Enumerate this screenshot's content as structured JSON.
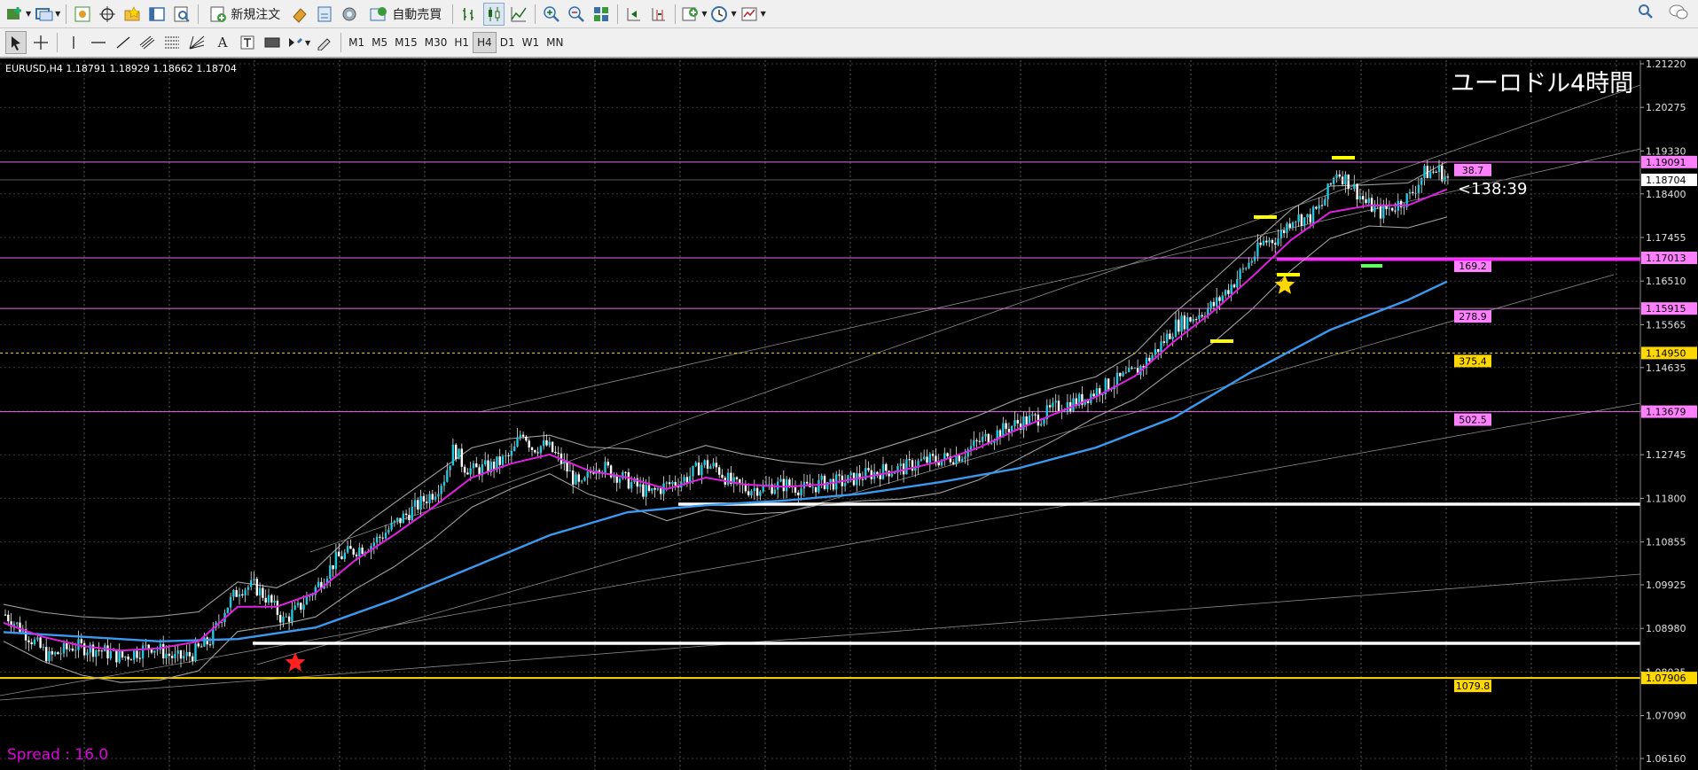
{
  "toolbar": {
    "new_order_label": "新規注文",
    "autotrade_label": "自動売買",
    "timeframes": [
      "M1",
      "M5",
      "M15",
      "M30",
      "H1",
      "H4",
      "D1",
      "W1",
      "MN"
    ],
    "active_timeframe": "H4",
    "text_tool_label": "A"
  },
  "chart": {
    "symbol_info": "EURUSD,H4  1.18791 1.18929 1.18662 1.18704",
    "title": "ユーロドル4時間",
    "countdown": "<138:39",
    "spread": "Spread : 16.0",
    "price_axis": [
      "1.21220",
      "1.20275",
      "1.19330",
      "1.18400",
      "1.17455",
      "1.16510",
      "1.15565",
      "1.14635",
      "1.13690",
      "1.12745",
      "1.11800",
      "1.10855",
      "1.09925",
      "1.08980",
      "1.08035",
      "1.07090",
      "1.06160"
    ],
    "level_tags": [
      {
        "price": "1.19091",
        "label": "38.7",
        "color": "#ff80ff"
      },
      {
        "price": "1.17013",
        "label": "169.2",
        "color": "#ff80ff"
      },
      {
        "price": "1.15915",
        "label": "278.9",
        "color": "#ff80ff"
      },
      {
        "price": "1.14950",
        "label": "375.4",
        "color": "#ffd700"
      },
      {
        "price": "1.13679",
        "label": "502.5",
        "color": "#ff80ff"
      },
      {
        "price": "1.07906",
        "label": "1079.8",
        "color": "#ffd700"
      }
    ],
    "current_price": "1.18704"
  },
  "chart_data": {
    "type": "candlestick",
    "symbol": "EURUSD",
    "timeframe": "H4",
    "ylim": [
      1.0616,
      1.2122
    ],
    "last_ohlc": {
      "open": 1.18791,
      "high": 1.18929,
      "low": 1.18662,
      "close": 1.18704
    },
    "horizontal_levels": [
      1.19091,
      1.17013,
      1.15915,
      1.1495,
      1.13679,
      1.07906
    ],
    "close_path": [
      [
        0,
        1.0928
      ],
      [
        20,
        1.089
      ],
      [
        45,
        1.0835
      ],
      [
        70,
        1.086
      ],
      [
        95,
        1.0852
      ],
      [
        120,
        1.0835
      ],
      [
        150,
        1.086
      ],
      [
        175,
        1.0832
      ],
      [
        190,
        1.084
      ],
      [
        210,
        1.0872
      ],
      [
        225,
        1.094
      ],
      [
        240,
        1.0985
      ],
      [
        255,
        1.099
      ],
      [
        270,
        1.096
      ],
      [
        285,
        1.0915
      ],
      [
        300,
        1.094
      ],
      [
        320,
        1.099
      ],
      [
        340,
        1.105
      ],
      [
        360,
        1.107
      ],
      [
        375,
        1.108
      ],
      [
        400,
        1.1125
      ],
      [
        420,
        1.116
      ],
      [
        440,
        1.1195
      ],
      [
        450,
        1.1225
      ],
      [
        460,
        1.129
      ],
      [
        470,
        1.125
      ],
      [
        480,
        1.124
      ],
      [
        500,
        1.125
      ],
      [
        520,
        1.1275
      ],
      [
        530,
        1.133
      ],
      [
        540,
        1.129
      ],
      [
        555,
        1.1295
      ],
      [
        570,
        1.126
      ],
      [
        590,
        1.12
      ],
      [
        605,
        1.1255
      ],
      [
        620,
        1.124
      ],
      [
        640,
        1.1215
      ],
      [
        660,
        1.119
      ],
      [
        680,
        1.121
      ],
      [
        700,
        1.1225
      ],
      [
        715,
        1.1255
      ],
      [
        730,
        1.1245
      ],
      [
        745,
        1.121
      ],
      [
        760,
        1.12
      ],
      [
        780,
        1.1205
      ],
      [
        800,
        1.121
      ],
      [
        820,
        1.12
      ],
      [
        840,
        1.1215
      ],
      [
        860,
        1.1215
      ],
      [
        880,
        1.123
      ],
      [
        900,
        1.124
      ],
      [
        920,
        1.1245
      ],
      [
        940,
        1.126
      ],
      [
        960,
        1.1265
      ],
      [
        980,
        1.1275
      ],
      [
        1000,
        1.1305
      ],
      [
        1020,
        1.1325
      ],
      [
        1040,
        1.1345
      ],
      [
        1060,
        1.1355
      ],
      [
        1080,
        1.138
      ],
      [
        1100,
        1.139
      ],
      [
        1120,
        1.1415
      ],
      [
        1140,
        1.1435
      ],
      [
        1160,
        1.1455
      ],
      [
        1180,
        1.15
      ],
      [
        1200,
        1.1555
      ],
      [
        1220,
        1.1575
      ],
      [
        1240,
        1.16
      ],
      [
        1260,
        1.165
      ],
      [
        1275,
        1.169
      ],
      [
        1290,
        1.1735
      ],
      [
        1305,
        1.1745
      ],
      [
        1320,
        1.179
      ],
      [
        1335,
        1.1785
      ],
      [
        1350,
        1.1815
      ],
      [
        1365,
        1.189
      ],
      [
        1380,
        1.186
      ],
      [
        1395,
        1.182
      ],
      [
        1410,
        1.18
      ],
      [
        1425,
        1.1815
      ],
      [
        1440,
        1.1835
      ],
      [
        1455,
        1.1885
      ],
      [
        1470,
        1.189
      ],
      [
        1480,
        1.187
      ]
    ],
    "ma_fast_path": [
      [
        0,
        1.091
      ],
      [
        40,
        1.088
      ],
      [
        80,
        1.086
      ],
      [
        120,
        1.085
      ],
      [
        160,
        1.0855
      ],
      [
        200,
        1.087
      ],
      [
        240,
        1.0945
      ],
      [
        280,
        1.0945
      ],
      [
        320,
        1.0975
      ],
      [
        360,
        1.1045
      ],
      [
        400,
        1.11
      ],
      [
        440,
        1.116
      ],
      [
        480,
        1.1225
      ],
      [
        520,
        1.1255
      ],
      [
        560,
        1.1275
      ],
      [
        600,
        1.124
      ],
      [
        640,
        1.1225
      ],
      [
        680,
        1.12
      ],
      [
        720,
        1.1225
      ],
      [
        760,
        1.121
      ],
      [
        800,
        1.1205
      ],
      [
        840,
        1.121
      ],
      [
        880,
        1.1225
      ],
      [
        920,
        1.124
      ],
      [
        960,
        1.126
      ],
      [
        1000,
        1.129
      ],
      [
        1040,
        1.133
      ],
      [
        1080,
        1.1365
      ],
      [
        1120,
        1.14
      ],
      [
        1160,
        1.1445
      ],
      [
        1200,
        1.152
      ],
      [
        1240,
        1.1585
      ],
      [
        1280,
        1.166
      ],
      [
        1320,
        1.174
      ],
      [
        1360,
        1.18
      ],
      [
        1400,
        1.1815
      ],
      [
        1440,
        1.1815
      ],
      [
        1480,
        1.185
      ]
    ],
    "ma_slow_path": [
      [
        0,
        1.089
      ],
      [
        80,
        1.088
      ],
      [
        160,
        1.087
      ],
      [
        240,
        1.0875
      ],
      [
        320,
        1.09
      ],
      [
        400,
        1.096
      ],
      [
        480,
        1.103
      ],
      [
        560,
        1.11
      ],
      [
        640,
        1.115
      ],
      [
        720,
        1.1165
      ],
      [
        800,
        1.1175
      ],
      [
        880,
        1.119
      ],
      [
        960,
        1.1215
      ],
      [
        1040,
        1.1245
      ],
      [
        1120,
        1.129
      ],
      [
        1200,
        1.1355
      ],
      [
        1280,
        1.1455
      ],
      [
        1360,
        1.1545
      ],
      [
        1440,
        1.161
      ],
      [
        1480,
        1.165
      ]
    ]
  }
}
